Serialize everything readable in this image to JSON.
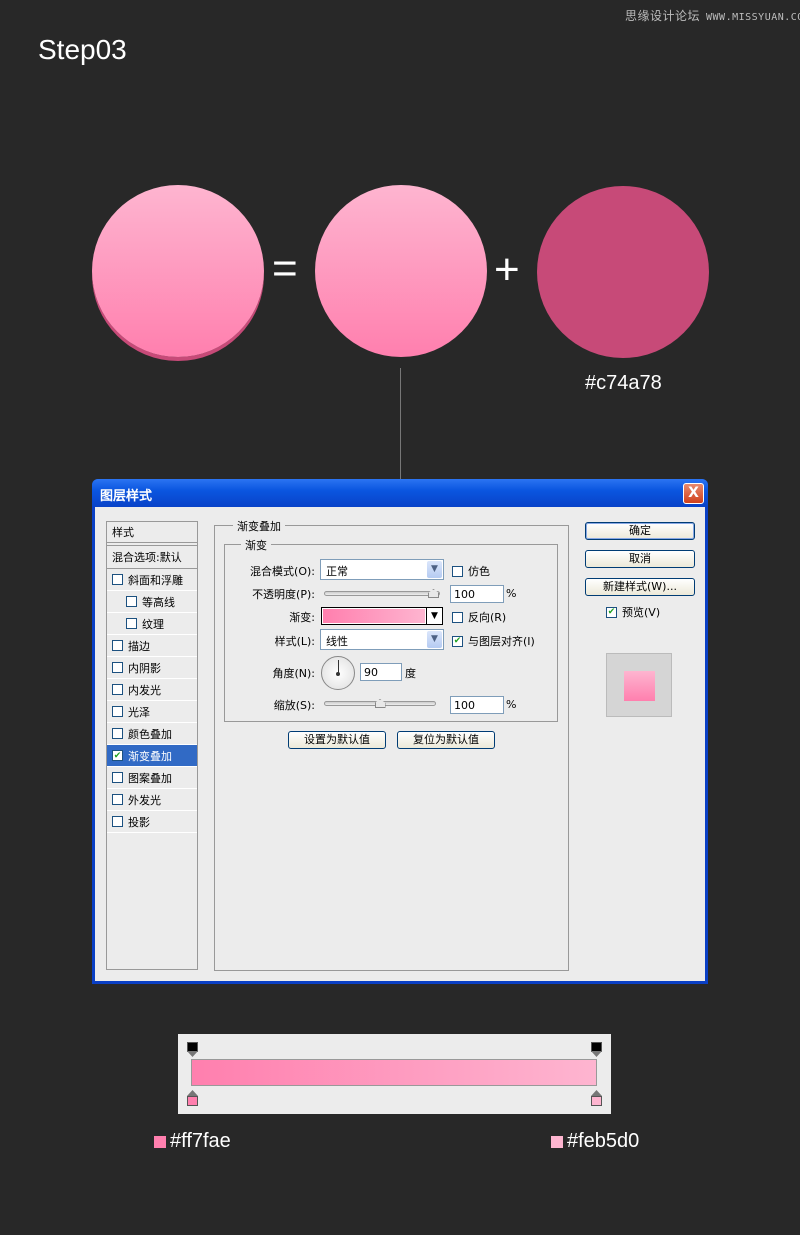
{
  "watermark": {
    "site_name": "思缘设计论坛",
    "url": "WWW.MISSYUAN.COM"
  },
  "step_title": "Step03",
  "equation": {
    "operators": {
      "equals": "=",
      "plus": "+"
    },
    "circles": [
      {
        "name": "result",
        "gradient": [
          "#feb5d0",
          "#ff7fae"
        ],
        "shadow": "#c74a78"
      },
      {
        "name": "gradient-layer",
        "gradient": [
          "#feb5d0",
          "#ff7fae"
        ]
      },
      {
        "name": "shadow-layer",
        "color": "#c74a78"
      }
    ],
    "shadow_color_label": "#c74a78"
  },
  "dialog": {
    "title": "图层样式",
    "close_label": "X",
    "style_list": {
      "header": "样式",
      "blend_options": "混合选项:默认",
      "items": [
        {
          "label": "斜面和浮雕",
          "checked": false,
          "sub": false
        },
        {
          "label": "等高线",
          "checked": false,
          "sub": true
        },
        {
          "label": "纹理",
          "checked": false,
          "sub": true
        },
        {
          "label": "描边",
          "checked": false,
          "sub": false
        },
        {
          "label": "内阴影",
          "checked": false,
          "sub": false
        },
        {
          "label": "内发光",
          "checked": false,
          "sub": false
        },
        {
          "label": "光泽",
          "checked": false,
          "sub": false
        },
        {
          "label": "颜色叠加",
          "checked": false,
          "sub": false
        },
        {
          "label": "渐变叠加",
          "checked": true,
          "sub": false,
          "active": true
        },
        {
          "label": "图案叠加",
          "checked": false,
          "sub": false
        },
        {
          "label": "外发光",
          "checked": false,
          "sub": false
        },
        {
          "label": "投影",
          "checked": false,
          "sub": false
        }
      ]
    },
    "panel": {
      "title": "渐变叠加",
      "section_title": "渐变",
      "blend_mode": {
        "label": "混合模式(O):",
        "value": "正常"
      },
      "dither": {
        "label": "仿色",
        "checked": false
      },
      "opacity": {
        "label": "不透明度(P):",
        "value": "100",
        "unit": "%",
        "fraction": 1.0
      },
      "gradient": {
        "label": "渐变:",
        "colors": [
          "#ff7fae",
          "#feb5d0"
        ]
      },
      "reverse": {
        "label": "反向(R)",
        "checked": false
      },
      "style": {
        "label": "样式(L):",
        "value": "线性"
      },
      "align_with_layer": {
        "label": "与图层对齐(I)",
        "checked": true
      },
      "angle": {
        "label": "角度(N):",
        "value": "90",
        "unit": "度"
      },
      "scale": {
        "label": "缩放(S):",
        "value": "100",
        "unit": "%",
        "fraction": 0.5
      },
      "make_default": "设置为默认值",
      "reset_default": "复位为默认值"
    },
    "buttons": {
      "ok": "确定",
      "cancel": "取消",
      "new_style": "新建样式(W)...",
      "preview": {
        "label": "预览(V)",
        "checked": true
      }
    }
  },
  "gradient_editor": {
    "start_color": "#ff7fae",
    "end_color": "#feb5d0"
  },
  "swatches": [
    {
      "label": "#ff7fae",
      "color": "#ff7fae"
    },
    {
      "label": "#feb5d0",
      "color": "#feb5d0"
    }
  ]
}
